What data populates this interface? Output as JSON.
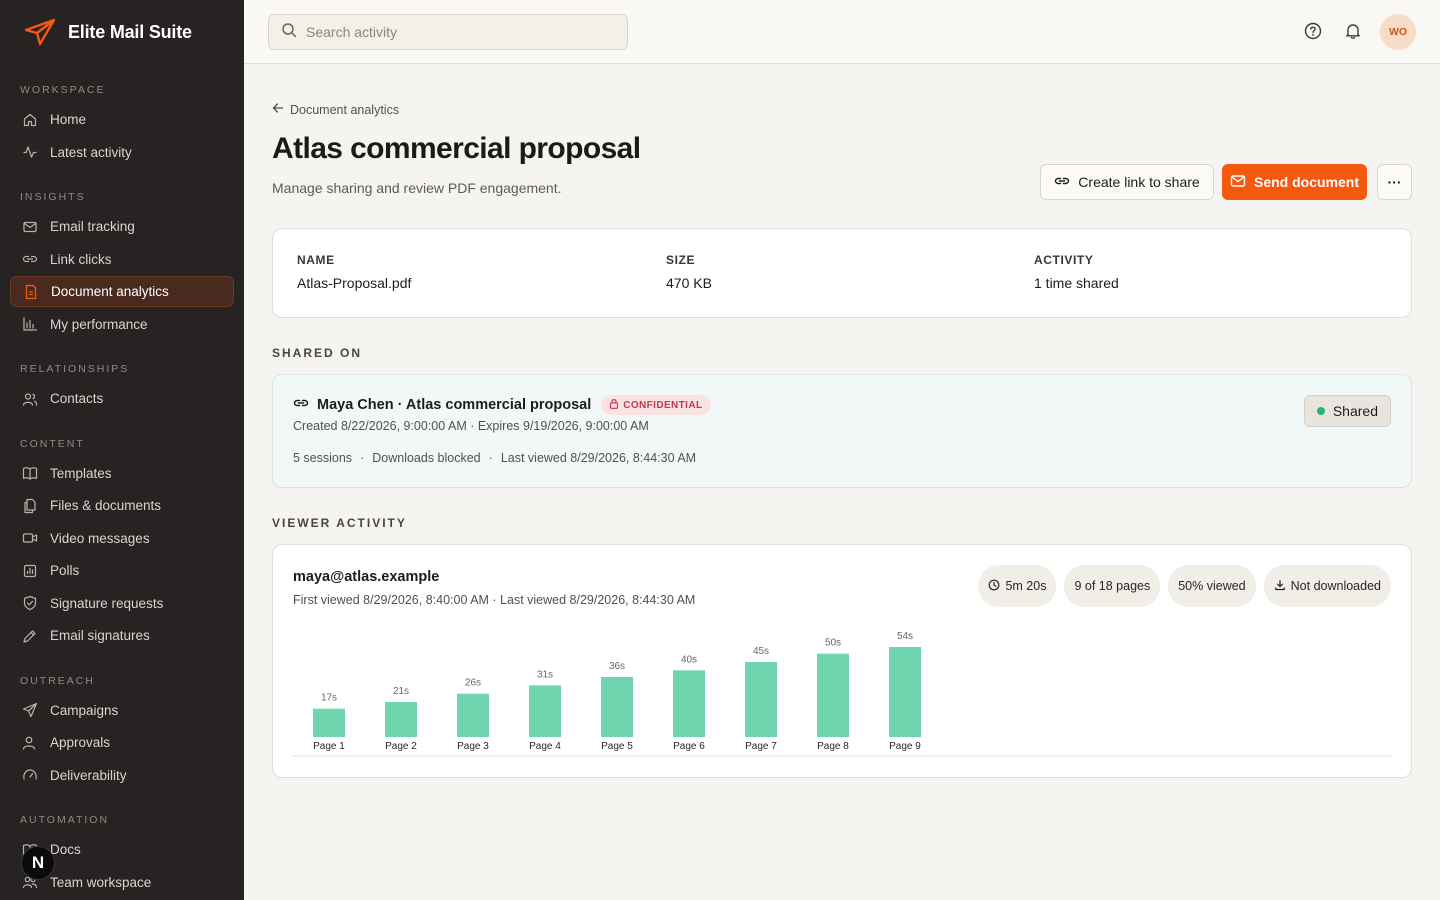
{
  "app": {
    "name": "Elite Mail Suite"
  },
  "sidebar": {
    "sections": [
      {
        "label": "WORKSPACE",
        "items": [
          {
            "label": "Home",
            "icon": "home-icon"
          },
          {
            "label": "Latest activity",
            "icon": "activity-icon"
          }
        ]
      },
      {
        "label": "INSIGHTS",
        "items": [
          {
            "label": "Email tracking",
            "icon": "mail-icon"
          },
          {
            "label": "Link clicks",
            "icon": "link-icon"
          },
          {
            "label": "Document analytics",
            "icon": "document-icon",
            "active": true
          },
          {
            "label": "My performance",
            "icon": "bar-chart-icon"
          }
        ]
      },
      {
        "label": "RELATIONSHIPS",
        "items": [
          {
            "label": "Contacts",
            "icon": "users-icon"
          }
        ]
      },
      {
        "label": "CONTENT",
        "items": [
          {
            "label": "Templates",
            "icon": "book-icon"
          },
          {
            "label": "Files & documents",
            "icon": "files-icon"
          },
          {
            "label": "Video messages",
            "icon": "video-icon"
          },
          {
            "label": "Polls",
            "icon": "poll-icon"
          },
          {
            "label": "Signature requests",
            "icon": "shield-icon"
          },
          {
            "label": "Email signatures",
            "icon": "pen-icon"
          }
        ]
      },
      {
        "label": "OUTREACH",
        "items": [
          {
            "label": "Campaigns",
            "icon": "send-icon"
          },
          {
            "label": "Approvals",
            "icon": "user-check-icon"
          },
          {
            "label": "Deliverability",
            "icon": "gauge-icon"
          }
        ]
      },
      {
        "label": "AUTOMATION",
        "items": [
          {
            "label": "Docs",
            "icon": "book-icon"
          },
          {
            "label": "Team workspace",
            "icon": "team-icon"
          }
        ]
      }
    ],
    "bottom_badge": "N"
  },
  "topbar": {
    "search_placeholder": "Search activity",
    "avatar_initials": "WO"
  },
  "page": {
    "breadcrumb": "Document analytics",
    "title": "Atlas commercial proposal",
    "subtitle": "Manage sharing and review PDF engagement.",
    "create_link_label": "Create link to share",
    "send_label": "Send document",
    "more_label": "···"
  },
  "file_info": {
    "name_label": "NAME",
    "name_value": "Atlas-Proposal.pdf",
    "size_label": "SIZE",
    "size_value": "470 KB",
    "activity_label": "ACTIVITY",
    "activity_value": "1 time shared"
  },
  "shared_on": {
    "section_label": "SHARED ON",
    "title": "Maya Chen · Atlas commercial proposal",
    "badge": "CONFIDENTIAL",
    "meta": "Created 8/22/2026, 9:00:00 AM · Expires 9/19/2026, 9:00:00 AM",
    "sessions": "5 sessions",
    "downloads": "Downloads blocked",
    "last_viewed": "Last viewed 8/29/2026, 8:44:30 AM",
    "status": "Shared",
    "sep": "·"
  },
  "viewer": {
    "section_label": "VIEWER ACTIVITY",
    "email": "maya@atlas.example",
    "meta": "First viewed 8/29/2026, 8:40:00 AM · Last viewed 8/29/2026, 8:44:30 AM",
    "time_pill": "5m 20s",
    "pages_pill": "9 of 18 pages",
    "viewed_pill": "50% viewed",
    "download_pill": "Not downloaded"
  },
  "chart_data": {
    "type": "bar",
    "categories": [
      "Page 1",
      "Page 2",
      "Page 3",
      "Page 4",
      "Page 5",
      "Page 6",
      "Page 7",
      "Page 8",
      "Page 9"
    ],
    "values": [
      17,
      21,
      26,
      31,
      36,
      40,
      45,
      50,
      54
    ],
    "data_labels": [
      "17s",
      "21s",
      "26s",
      "31s",
      "36s",
      "40s",
      "45s",
      "50s",
      "54s"
    ],
    "unit": "seconds",
    "color": "#6fd6b0",
    "ylim": [
      0,
      54
    ]
  },
  "colors": {
    "accent": "#f5580f",
    "sidebar": "#262322",
    "bar": "#6fd6b0"
  }
}
